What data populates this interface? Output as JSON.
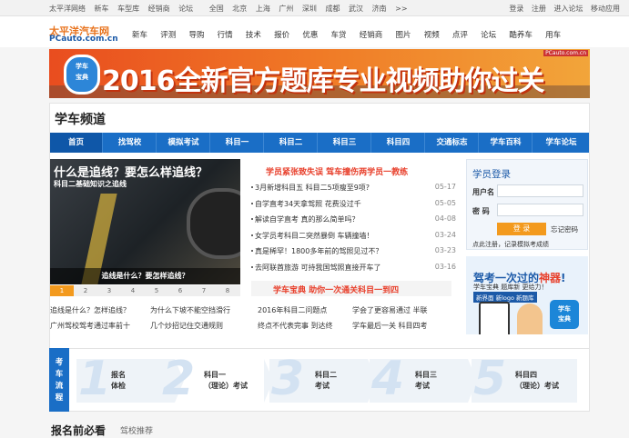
{
  "topbar": {
    "left": [
      "太平洋网络",
      "新车",
      "车型库",
      "经销商",
      "论坛",
      "全国",
      "北京",
      "上海",
      "广州",
      "深圳",
      "成都",
      "武汉",
      "济南",
      ">>"
    ],
    "right": [
      "登录",
      "注册",
      "进入论坛",
      "移动应用"
    ]
  },
  "logo": {
    "cn": "太平洋汽车网",
    "en": "PCauto.com.cn"
  },
  "mainnav": [
    "新车",
    "评测",
    "导购",
    "行情",
    "技术",
    "报价",
    "优惠",
    "车贷",
    "经销商",
    "图片",
    "视频",
    "点评",
    "论坛",
    "酷养车",
    "用车"
  ],
  "banner": {
    "text": "2016全新官方题库专业视频助你过关",
    "badge": "学车\n宝典",
    "url": "PCauto.com.cn"
  },
  "channel_title": "学车频道",
  "tabs": [
    "首页",
    "找驾校",
    "模拟考试",
    "科目一",
    "科目二",
    "科目三",
    "科目四",
    "交通标志",
    "学车百科",
    "学车论坛"
  ],
  "feature": {
    "headline": "什么是追线？要怎么样追线？",
    "subhead": "科目二基础知识之追线",
    "caption": "追线是什么？要怎样追线？",
    "pages": [
      "1",
      "2",
      "3",
      "4",
      "5",
      "6",
      "7",
      "8"
    ]
  },
  "headline1": "学员紧张致失误 驾车撞伤两学员一教练",
  "news": [
    {
      "title": "3月新增科目五 科目二5项瘦至9项?",
      "date": "05-17"
    },
    {
      "title": "自学直考34天拿驾照 花费没过千",
      "date": "05-05"
    },
    {
      "title": "解读自学直考 真的那么简单吗？",
      "date": "04-08"
    },
    {
      "title": "女学员考科目二突然暴倒 车辆撞墙！",
      "date": "03-24"
    },
    {
      "title": "真是稀罕！1800多年前的驾照见过不？",
      "date": "03-23"
    },
    {
      "title": "去阿联酋旅游 可持我国驾照直接开车了",
      "date": "03-16"
    }
  ],
  "headline2": "学车宝典 助你一次通关科目一到四",
  "bottom_links": [
    [
      "追线是什么？怎样追线？",
      "为什么下坡不能空挡滑行",
      "2016年科目二问题点",
      "学会了更容易通过 半联"
    ],
    [
      "广州驾校驾考通过率前十",
      "几个炒招记住交通规则",
      "终点不代表完事 到达终",
      "学车最后一关 科目四考"
    ]
  ],
  "login": {
    "title": "学员登录",
    "user_label": "用户名",
    "pass_label": "密 码",
    "button": "登 录",
    "forget": "忘记密码",
    "tip": "点此注册，记录模拟考成绩"
  },
  "ad": {
    "line1a": "驾考一次过的",
    "line1b": "神器",
    "line2": "学车宝典 题库新 更给力！",
    "line3": "新界面 新logo 新题库",
    "app": "学车\n宝典"
  },
  "flow": {
    "label": "考车流程",
    "steps": [
      {
        "num": "1",
        "text": "报名\n体检"
      },
      {
        "num": "2",
        "text": "科目一\n（理论）考试"
      },
      {
        "num": "3",
        "text": "科目二\n考试"
      },
      {
        "num": "4",
        "text": "科目三\n考试"
      },
      {
        "num": "5",
        "text": "科目四\n（理论）考试"
      }
    ]
  },
  "bottom_head": [
    "报名前必看",
    "驾校推荐"
  ]
}
